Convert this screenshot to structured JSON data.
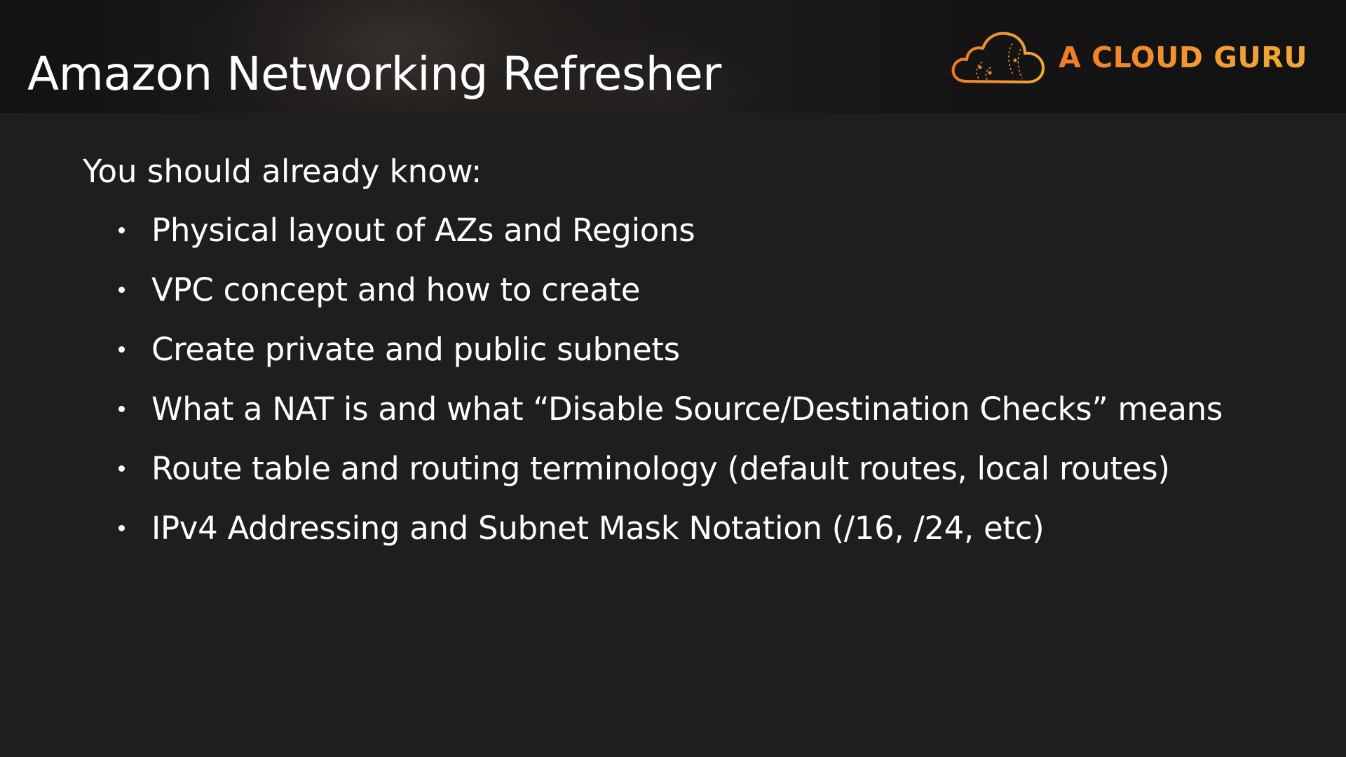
{
  "slide": {
    "title": "Amazon Networking Refresher",
    "logo": {
      "text": "A CLOUD GURU",
      "icon": "cloud-icon",
      "color": "#f0922f"
    },
    "intro": "You should already know:",
    "bullets": [
      "Physical layout of AZs and Regions",
      "VPC concept and how to create",
      "Create private and public subnets",
      "What a NAT is and what “Disable Source/Destination Checks” means",
      "Route table and routing terminology (default routes, local routes)",
      "IPv4 Addressing and Subnet Mask Notation (/16, /24, etc)"
    ]
  },
  "colors": {
    "background": "#1e1e1e",
    "header": "#141414",
    "text": "#ffffff",
    "accent": "#f0922f"
  }
}
